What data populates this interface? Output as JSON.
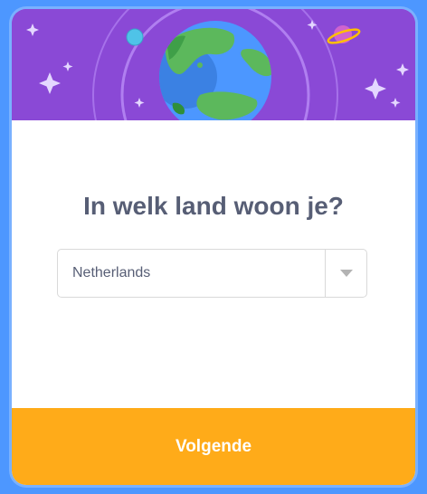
{
  "dialog": {
    "question": "In welk land woon je?",
    "country_select": {
      "selected_value": "Netherlands"
    },
    "next_button_label": "Volgende"
  },
  "header_art": {
    "icons": [
      "earth-icon",
      "planet-icon",
      "moon-icon",
      "sparkle-icon"
    ]
  },
  "colors": {
    "frame": "#4d97ff",
    "header": "#8a49d6",
    "title_text": "#575e75",
    "button": "#ffab19"
  }
}
